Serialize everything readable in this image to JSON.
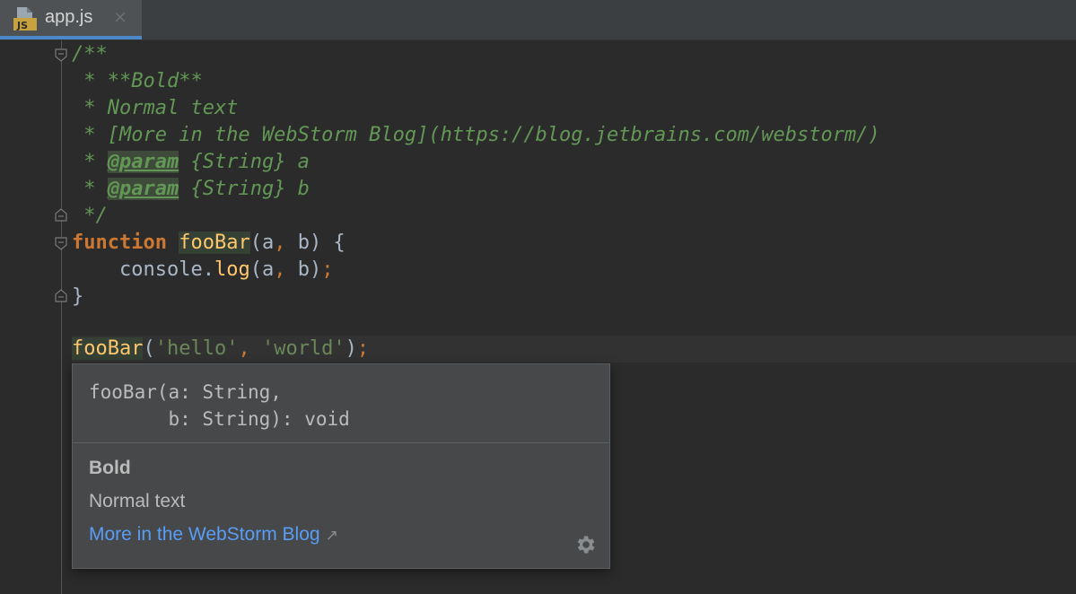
{
  "tab": {
    "title": "app.js",
    "icon_label": "JS",
    "close_glyph": "×"
  },
  "code": {
    "l1": "/**",
    "l2": " * **Bold**",
    "l3": " * Normal text",
    "l4": " * [More in the WebStorm Blog](https://blog.jetbrains.com/webstorm/)",
    "l5_prefix": " * ",
    "l5_tag": "@param",
    "l5_rest": " {String} a",
    "l6_prefix": " * ",
    "l6_tag": "@param",
    "l6_rest": " {String} b",
    "l7": " */",
    "l8_kw": "function",
    "l8_space": " ",
    "l8_fn": "fooBar",
    "l8_open": "(a",
    "l8_comma": ",",
    "l8_rest": " b) {",
    "l9_indent": "    console.",
    "l9_fn": "log",
    "l9_open": "(a",
    "l9_comma": ",",
    "l9_rest": " b)",
    "l9_semi": ";",
    "l10_brace": "}",
    "call_fn": "fooBar",
    "call_open": "(",
    "call_arg1": "'hello'",
    "call_comma": ",",
    "call_space": " ",
    "call_arg2": "'world'",
    "call_close": ")",
    "call_semi": ";"
  },
  "doc": {
    "signature": "fooBar(a: String,\n       b: String): void",
    "bold": "Bold",
    "normal": "Normal text",
    "link": "More in the WebStorm Blog",
    "link_arrow": "↗"
  },
  "colors": {
    "background": "#2b2b2b",
    "comment": "#629755",
    "keyword": "#cc7832",
    "function": "#ffc66d",
    "string": "#6a8759",
    "link": "#589df6",
    "tab_accent": "#4a88c7"
  }
}
